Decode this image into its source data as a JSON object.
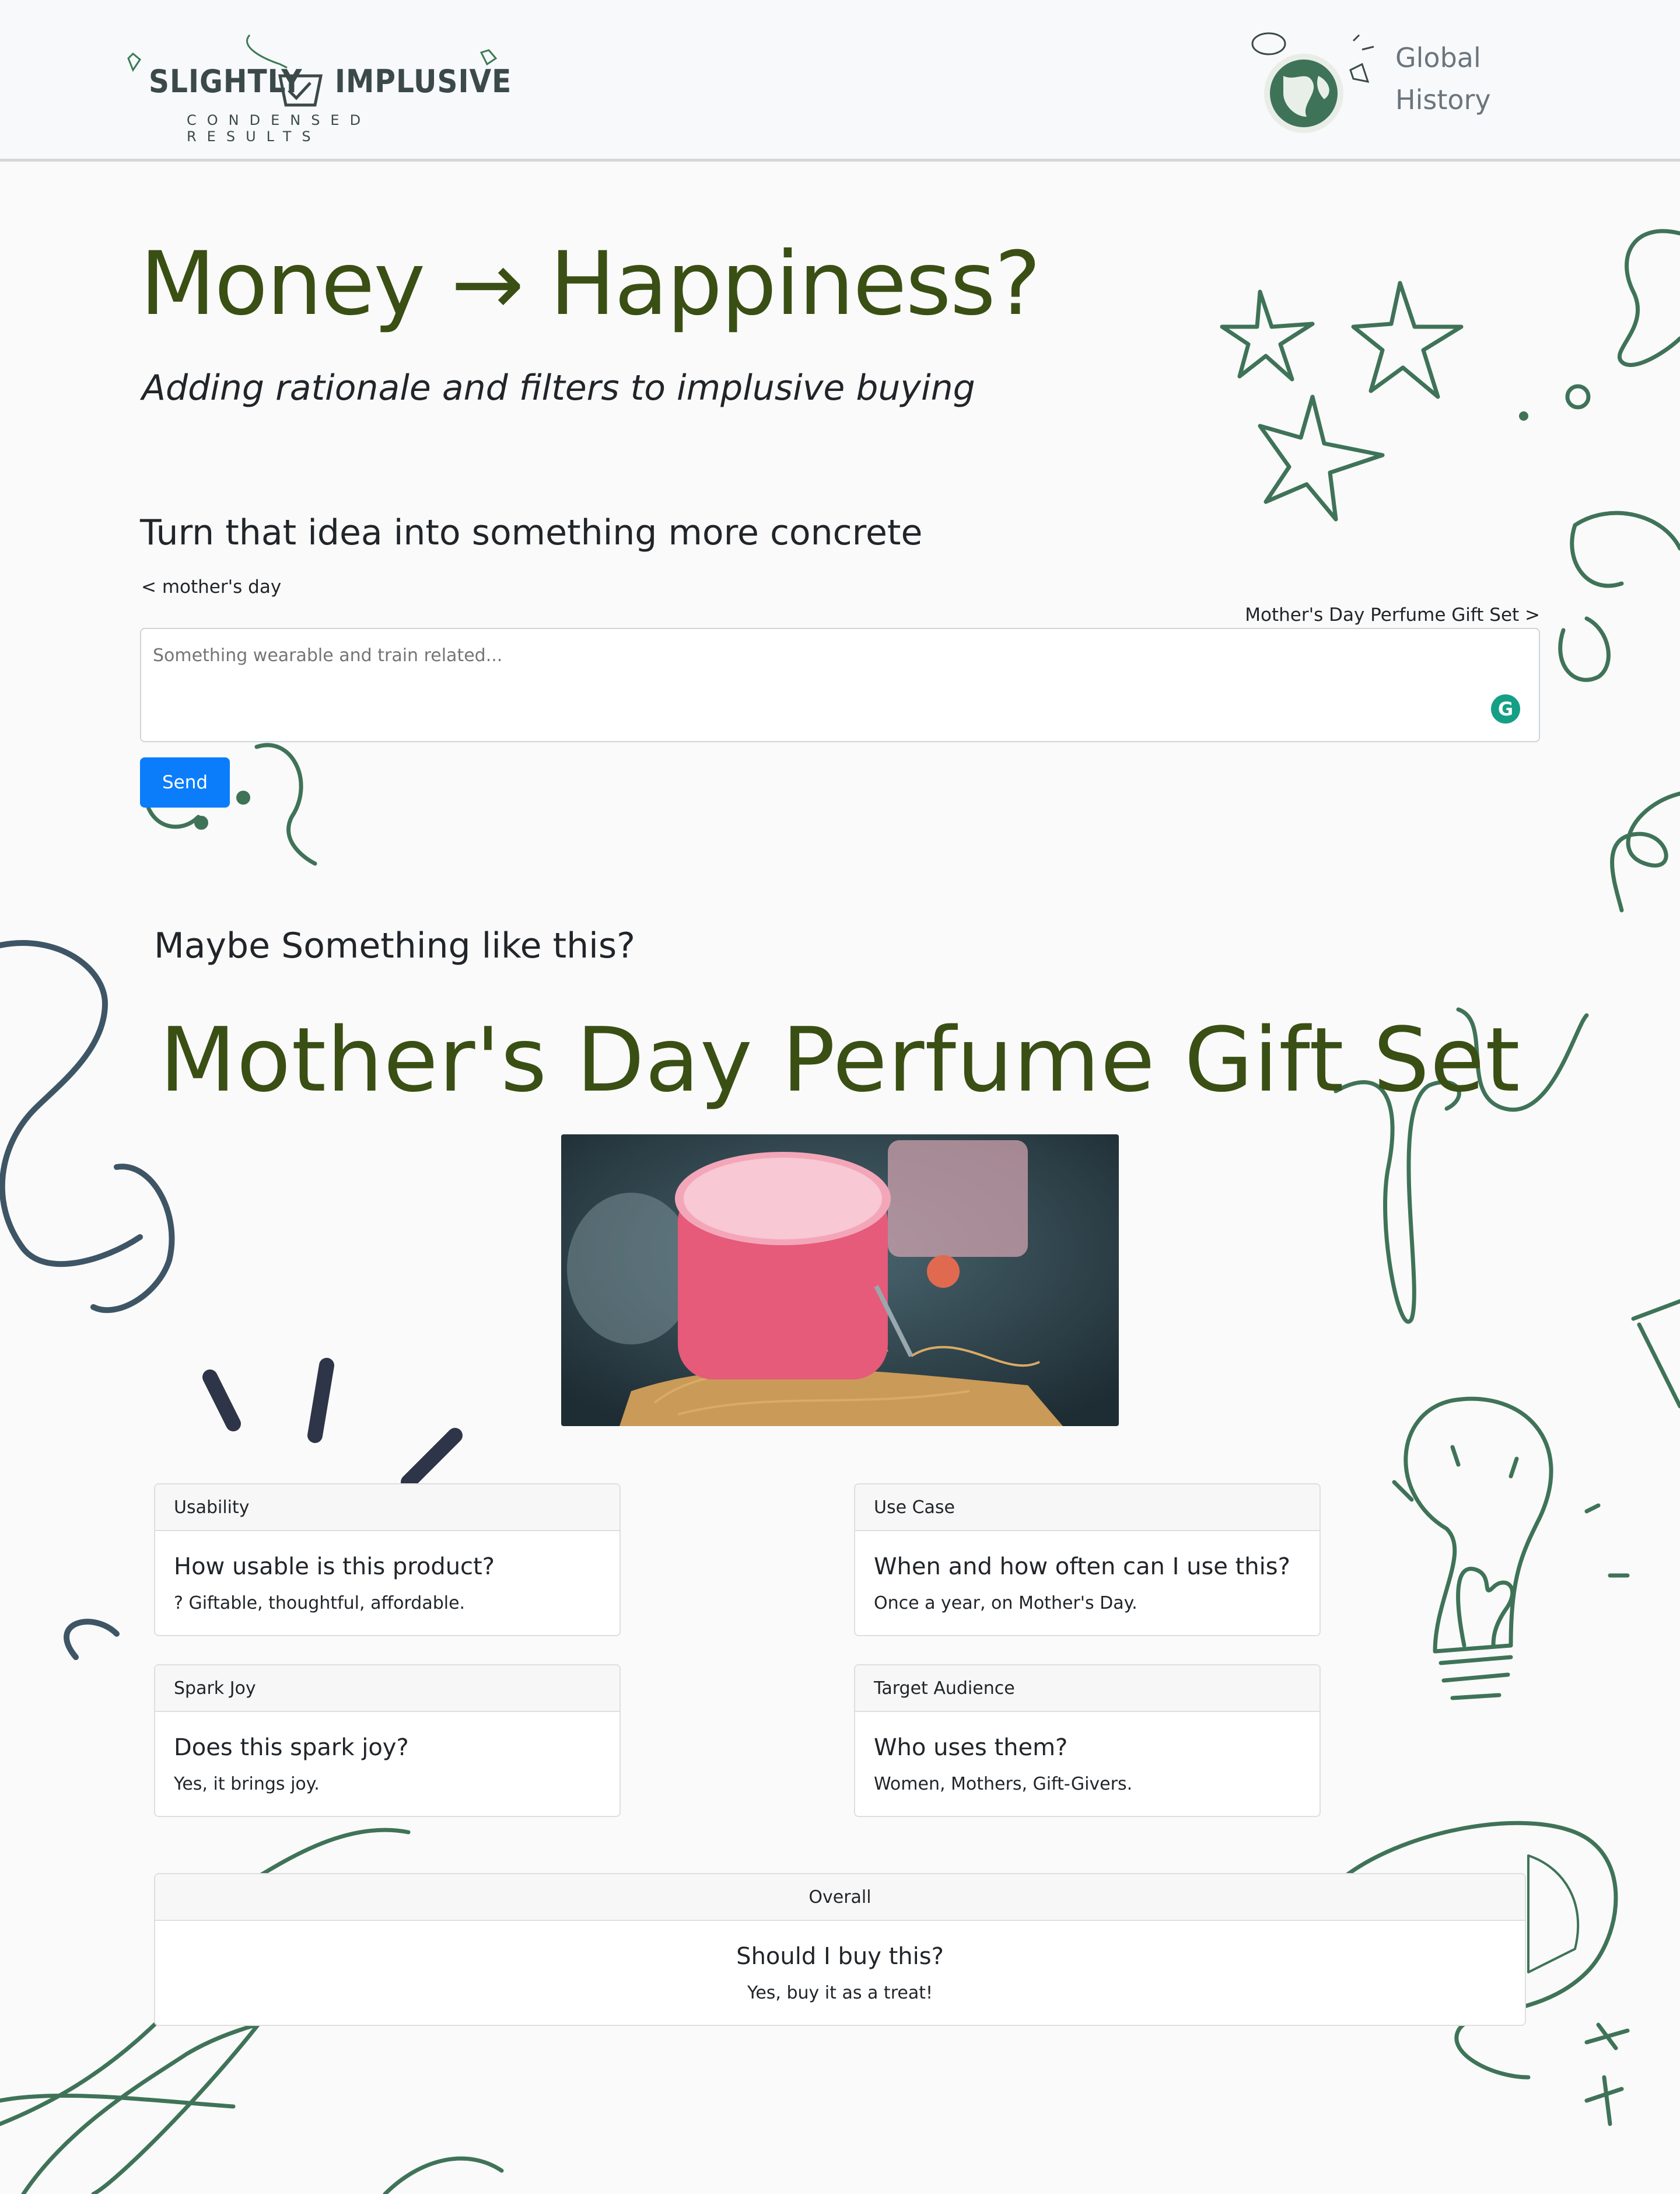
{
  "header": {
    "logo_word_left": "SLIGHTLY",
    "logo_word_right": "IMPLUSIVE",
    "logo_sub": "CONDENSED RESULTS",
    "nav_global": "Global",
    "nav_history": "History"
  },
  "hero": {
    "title": "Money → Happiness?",
    "subtitle": "Adding rationale and filters to implusive buying"
  },
  "idea": {
    "heading": "Turn that idea into something more concrete",
    "prev_link": "< mother's day",
    "next_link": "Mother's Day Perfume Gift Set >",
    "placeholder": "Something wearable and train related...",
    "send_label": "Send"
  },
  "result": {
    "heading": "Maybe Something like this?",
    "product_name": "Mother's Day Perfume Gift Set"
  },
  "cards": {
    "usability": {
      "header": "Usability",
      "question": "How usable is this product?",
      "answer": "? Giftable, thoughtful, affordable."
    },
    "use_case": {
      "header": "Use Case",
      "question": "When and how often can I use this?",
      "answer": "Once a year, on Mother's Day."
    },
    "spark_joy": {
      "header": "Spark Joy",
      "question": "Does this spark  joy?",
      "answer": "Yes, it brings  joy."
    },
    "target_audience": {
      "header": "Target Audience",
      "question": "Who uses them?",
      "answer": "Women, Mothers, Gift-Givers."
    },
    "overall": {
      "header": "Overall",
      "question": "Should I buy this?",
      "answer": "Yes, buy it as a treat!"
    }
  },
  "colors": {
    "title_green": "#3a4f14",
    "doodle_green": "#3f7358",
    "doodle_slate": "#3e5566",
    "button_blue": "#0b7dfb"
  }
}
